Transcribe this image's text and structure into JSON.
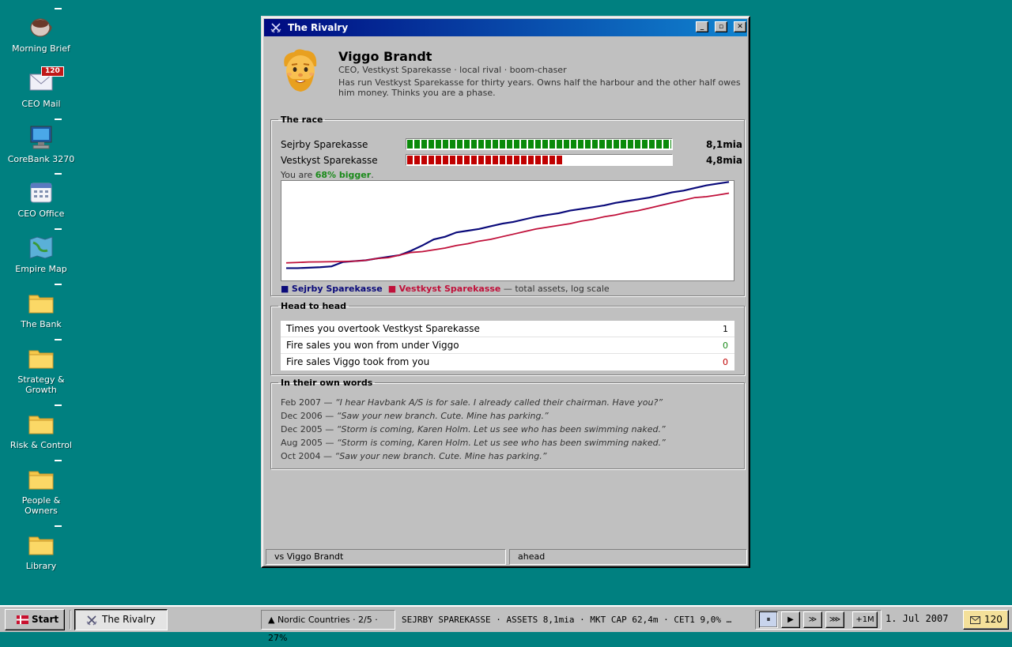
{
  "desktop": {
    "icons": [
      {
        "label": "Morning Brief",
        "icon": "coffee-cup-icon"
      },
      {
        "label": "CEO Mail",
        "icon": "mail-icon",
        "badge": "120"
      },
      {
        "label": "CoreBank 3270",
        "icon": "terminal-icon"
      },
      {
        "label": "CEO Office",
        "icon": "calendar-icon"
      },
      {
        "label": "Empire Map",
        "icon": "map-icon"
      },
      {
        "label": "The Bank",
        "icon": "folder-icon"
      },
      {
        "label": "Strategy & Growth",
        "icon": "folder-icon"
      },
      {
        "label": "Risk & Control",
        "icon": "folder-icon"
      },
      {
        "label": "People & Owners",
        "icon": "folder-icon"
      },
      {
        "label": "Library",
        "icon": "folder-icon"
      }
    ]
  },
  "window": {
    "title": "The Rivalry",
    "title_icon": "crossed-swords-icon",
    "controls": {
      "minimize": "_",
      "maximize": "▫",
      "close": "✕"
    }
  },
  "profile": {
    "name": "Viggo Brandt",
    "role": "CEO, Vestkyst Sparekasse · local rival · boom-chaser",
    "bio": "Has run Vestkyst Sparekasse for thirty years. Owns half the harbour and the other half owes him money. Thinks you are a phase.",
    "avatar": "bearded-man-avatar"
  },
  "race": {
    "legend": "The race",
    "rows": [
      {
        "name": "Sejrby Sparekasse",
        "value": "8,1mia",
        "fill": 1.0,
        "color": "#0a8a0a"
      },
      {
        "name": "Vestkyst Sparekasse",
        "value": "4,8mia",
        "fill": 0.593,
        "color": "#c00000"
      }
    ],
    "summary_prefix": "You are ",
    "summary_highlight": "68% bigger",
    "summary_suffix": ".",
    "legend_series": [
      {
        "name": "Sejrby Sparekasse",
        "color": "#0a0a7a"
      },
      {
        "name": "Vestkyst Sparekasse",
        "color": "#c0103a"
      }
    ],
    "legend_suffix": "— total assets, log scale"
  },
  "chart_data": {
    "type": "line",
    "x": [
      0,
      1,
      2,
      3,
      4,
      5,
      6,
      7,
      8,
      9,
      10,
      11,
      12,
      13,
      14,
      15,
      16,
      17,
      18,
      19,
      20,
      21,
      22,
      23,
      24,
      25,
      26,
      27,
      28,
      29,
      30,
      31,
      32,
      33,
      34,
      35,
      36,
      37,
      38,
      39
    ],
    "ylim": [
      0,
      100
    ],
    "log_scale": true,
    "series": [
      {
        "name": "Sejrby Sparekasse",
        "color": "#0a0a7a",
        "values": [
          7,
          7,
          7.5,
          8,
          9,
          14,
          15,
          16,
          18,
          20,
          22,
          27,
          33,
          40,
          43,
          48,
          50,
          52,
          55,
          58,
          60,
          63,
          66,
          68,
          70,
          73,
          75,
          77,
          79,
          82,
          84,
          86,
          88,
          91,
          94,
          96,
          99,
          102,
          104,
          106
        ]
      },
      {
        "name": "Vestkyst Sparekasse",
        "color": "#c0103a",
        "values": [
          13,
          13.5,
          14,
          14.2,
          14.4,
          14.6,
          15,
          16,
          18,
          19,
          22,
          25,
          26,
          28,
          30,
          33,
          35,
          38,
          40,
          43,
          46,
          49,
          52,
          54,
          56,
          58,
          61,
          63,
          66,
          68,
          71,
          73,
          76,
          79,
          82,
          85,
          88,
          89,
          91,
          93
        ]
      }
    ]
  },
  "head_to_head": {
    "legend": "Head to head",
    "rows": [
      {
        "label": "Times you overtook Vestkyst Sparekasse",
        "value": "1",
        "color": "#000000"
      },
      {
        "label": "Fire sales you won from under Viggo",
        "value": "0",
        "color": "#1a8a1a"
      },
      {
        "label": "Fire sales Viggo took from you",
        "value": "0",
        "color": "#c00000"
      }
    ]
  },
  "quotes": {
    "legend": "In their own words",
    "items": [
      {
        "date": "Feb 2007",
        "text": "“I hear Havbank A/S is for sale. I already called their chairman. Have you?”"
      },
      {
        "date": "Dec 2006",
        "text": "“Saw your new branch. Cute. Mine has parking.”"
      },
      {
        "date": "Dec 2005",
        "text": "“Storm is coming, Karen Holm. Let us see who has been swimming naked.”"
      },
      {
        "date": "Aug 2005",
        "text": "“Storm is coming, Karen Holm. Let us see who has been swimming naked.”"
      },
      {
        "date": "Oct 2004",
        "text": "“Saw your new branch. Cute. Mine has parking.”"
      }
    ],
    "separator": " — "
  },
  "statusbar": {
    "left": "vs Viggo Brandt",
    "right": "ahead"
  },
  "taskbar": {
    "start": "Start",
    "active_task": "The Rivalry",
    "progress": "▲ Nordic Countries · 2/5 · 27%",
    "ticker": "SEJRBY SPAREKASSE · ASSETS 8,1mia · MKT CAP 62,4m · CET1 9,0% …",
    "speed_buttons": [
      "⏸",
      "▶",
      "≫",
      "⋙",
      "+1M"
    ],
    "date": "1. Jul 2007",
    "mail_count": "120"
  }
}
